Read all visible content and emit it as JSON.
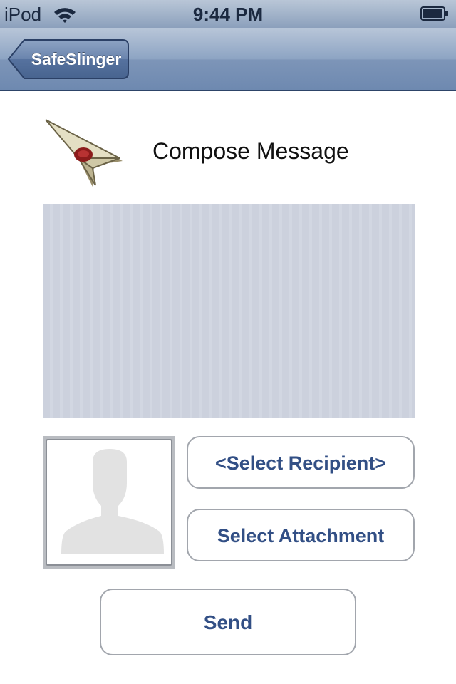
{
  "status_bar": {
    "carrier": "iPod",
    "time": "9:44 PM",
    "wifi_icon": "wifi-icon",
    "battery_icon": "battery-icon"
  },
  "nav": {
    "back_label": "SafeSlinger"
  },
  "header": {
    "icon": "paper-plane-wax-seal-icon",
    "title": "Compose Message"
  },
  "message": {
    "value": "",
    "placeholder": ""
  },
  "recipient": {
    "avatar_icon": "person-silhouette-icon",
    "select_label": "<Select Recipient>"
  },
  "attachment": {
    "select_label": "Select Attachment"
  },
  "actions": {
    "send_label": "Send"
  },
  "colors": {
    "nav_bar": "#7d95b8",
    "button_text": "#324f85",
    "message_area": "#ccd1dd"
  }
}
